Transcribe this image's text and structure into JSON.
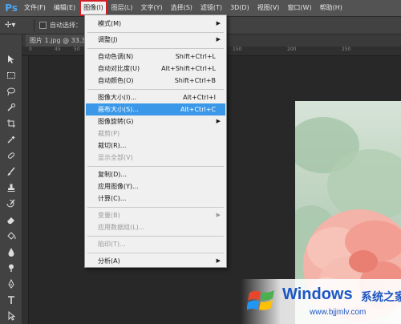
{
  "app": {
    "logo_text": "Ps",
    "logo_color": "#4ba6f3"
  },
  "menubar": {
    "items": [
      "文件(F)",
      "编辑(E)",
      "图像(I)",
      "图层(L)",
      "文字(Y)",
      "选择(S)",
      "滤镜(T)",
      "3D(D)",
      "视图(V)",
      "窗口(W)",
      "帮助(H)"
    ],
    "active_index": 2
  },
  "options": {
    "auto_select_label": "自动选择："
  },
  "document": {
    "tab_label": "图片 1.jpg @ 33.3",
    "ruler_ticks": [
      "0",
      "45",
      "50",
      "150",
      "200",
      "250"
    ]
  },
  "image_menu": {
    "items": [
      {
        "label": "模式(M)",
        "shortcut": "",
        "submenu": true,
        "disabled": false
      },
      {
        "label": "调整(J)",
        "shortcut": "",
        "submenu": true,
        "disabled": false
      },
      {
        "label": "自动色调(N)",
        "shortcut": "Shift+Ctrl+L",
        "submenu": false,
        "disabled": false
      },
      {
        "label": "自动对比度(U)",
        "shortcut": "Alt+Shift+Ctrl+L",
        "submenu": false,
        "disabled": false
      },
      {
        "label": "自动颜色(O)",
        "shortcut": "Shift+Ctrl+B",
        "submenu": false,
        "disabled": false
      },
      {
        "label": "图像大小(I)...",
        "shortcut": "Alt+Ctrl+I",
        "submenu": false,
        "disabled": false
      },
      {
        "label": "画布大小(S)...",
        "shortcut": "Alt+Ctrl+C",
        "submenu": false,
        "disabled": false,
        "highlighted": true
      },
      {
        "label": "图像旋转(G)",
        "shortcut": "",
        "submenu": true,
        "disabled": false
      },
      {
        "label": "裁剪(P)",
        "shortcut": "",
        "submenu": false,
        "disabled": true
      },
      {
        "label": "裁切(R)...",
        "shortcut": "",
        "submenu": false,
        "disabled": false
      },
      {
        "label": "显示全部(V)",
        "shortcut": "",
        "submenu": false,
        "disabled": true
      },
      {
        "label": "复制(D)...",
        "shortcut": "",
        "submenu": false,
        "disabled": false
      },
      {
        "label": "应用图像(Y)...",
        "shortcut": "",
        "submenu": false,
        "disabled": false
      },
      {
        "label": "计算(C)...",
        "shortcut": "",
        "submenu": false,
        "disabled": false
      },
      {
        "label": "变量(B)",
        "shortcut": "",
        "submenu": true,
        "disabled": true
      },
      {
        "label": "应用数据组(L)...",
        "shortcut": "",
        "submenu": false,
        "disabled": true
      },
      {
        "label": "陷印(T)...",
        "shortcut": "",
        "submenu": false,
        "disabled": true
      },
      {
        "label": "分析(A)",
        "shortcut": "",
        "submenu": true,
        "disabled": false
      }
    ]
  },
  "watermark": {
    "title": "Windows",
    "subtitle_cn": "系统之家",
    "url": "www.bjjmlv.com"
  },
  "colors": {
    "highlight": "#3b98e8",
    "active_outline": "#d21f25",
    "brand_blue": "#1b57c4"
  }
}
